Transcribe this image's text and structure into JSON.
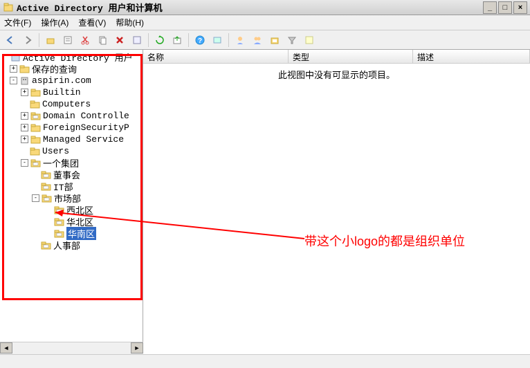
{
  "window": {
    "title": "Active Directory 用户和计算机",
    "buttons": {
      "min": "_",
      "max": "□",
      "close": "×"
    }
  },
  "menu": {
    "file": "文件(F)",
    "action": "操作(A)",
    "view": "查看(V)",
    "help": "帮助(H)"
  },
  "toolbar_icons": {
    "back": "back",
    "forward": "forward",
    "up": "up",
    "cut": "cut",
    "copy": "copy",
    "delete": "delete",
    "props": "props",
    "refresh": "refresh",
    "export": "export",
    "help": "help",
    "find": "find",
    "newuser": "newuser",
    "newgroup": "newgroup",
    "neworg": "neworg",
    "filter": "filter",
    "options": "options"
  },
  "tree": {
    "root": "Active Directory 用户",
    "saved": "保存的查询",
    "domain": "aspirin.com",
    "builtin": "Builtin",
    "computers": "Computers",
    "dc": "Domain Controlle",
    "fsp": "ForeignSecurityP",
    "msa": "Managed Service ",
    "users": "Users",
    "group": "一个集团",
    "board": "董事会",
    "it": "IT部",
    "market": "市场部",
    "nw": "西北区",
    "north": "华北区",
    "south": "华南区",
    "hr": "人事部"
  },
  "columns": {
    "name": "名称",
    "type": "类型",
    "desc": "描述"
  },
  "empty_msg": "此视图中没有可显示的项目。",
  "annotation": "带这个小logo的都是组织单位"
}
